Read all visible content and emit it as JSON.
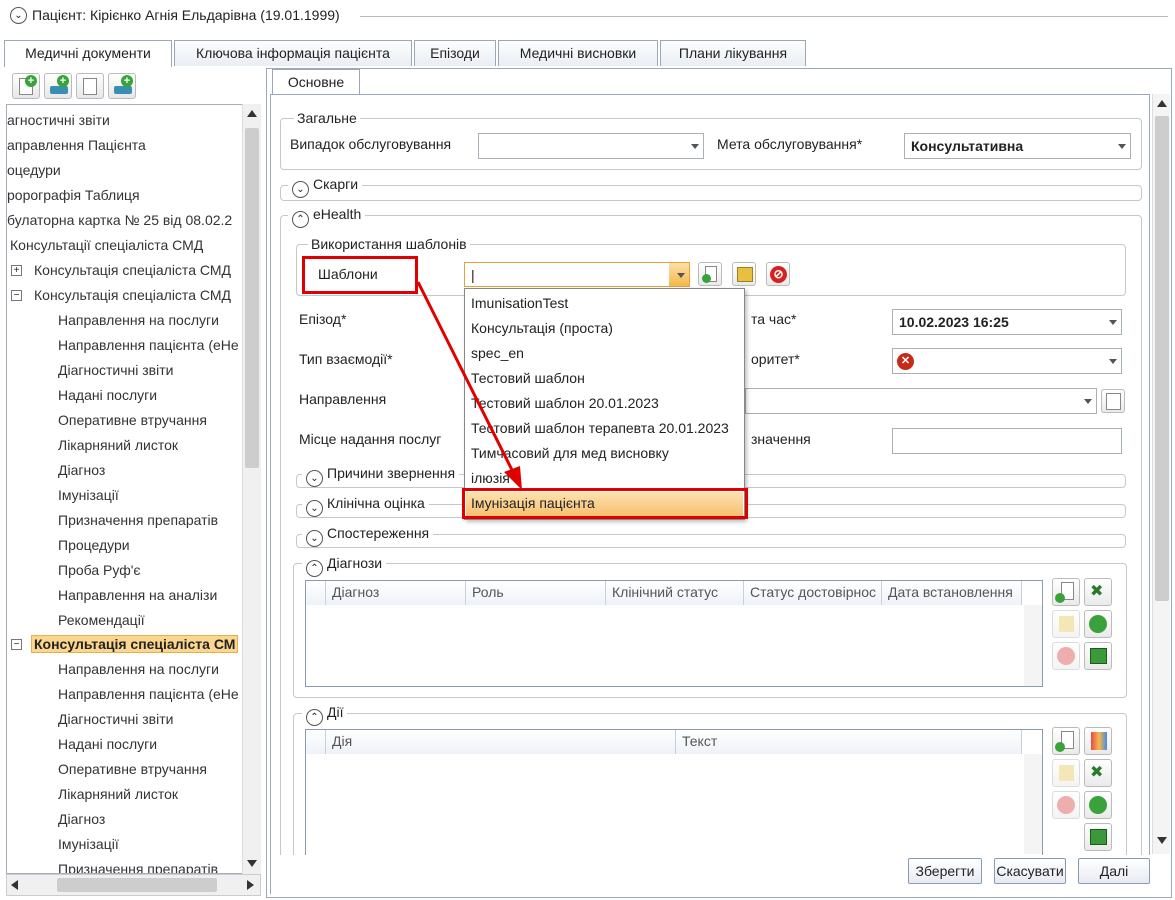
{
  "header": {
    "title": "Пацієнт: Кірієнко Агнія Ельдарівна (19.01.1999)"
  },
  "tabs": [
    {
      "label": "Медичні документи"
    },
    {
      "label": "Ключова інформація пацієнта"
    },
    {
      "label": "Епізоди"
    },
    {
      "label": "Медичні висновки"
    },
    {
      "label": "Плани лікування"
    }
  ],
  "tree": {
    "items": [
      "агностичні звіти",
      "аправлення Пацієнта",
      "оцедури",
      "рорографія Таблиця",
      "булаторна картка № 25 від 08.02.2",
      "Консультації спеціаліста СМД",
      "Консультація спеціаліста СМД",
      "Консультація спеціаліста СМД",
      "Направлення на послуги",
      "Направлення пацієнта (eHe",
      "Діагностичні звіти",
      "Надані послуги",
      "Оперативне втручання",
      "Лікарняний листок",
      "Діагноз",
      "Імунізації",
      "Призначення препаратів",
      "Процедури",
      "Проба Руф'є",
      "Направлення на аналізи",
      "Рекомендації",
      "Консультація спеціаліста СМ",
      "Направлення на послуги",
      "Направлення пацієнта (eHe",
      "Діагностичні звіти",
      "Надані послуги",
      "Оперативне втручання",
      "Лікарняний листок",
      "Діагноз",
      "Імунізації",
      "Призначення препаратів"
    ]
  },
  "subtab": {
    "label": "Основне"
  },
  "general": {
    "title": "Загальне",
    "case_label": "Випадок обслуговування",
    "case_value": "",
    "goal_label": "Мета обслуговування*",
    "goal_value": "Консультативна"
  },
  "sections": {
    "complaints": "Скарги",
    "ehealth": "eHealth",
    "templates_group": "Використання шаблонів",
    "templates_label": "Шаблони",
    "templates_value": "|",
    "episode_label": "Епізод*",
    "datetime_label": "та час*",
    "datetime_value": "10.02.2023 16:25",
    "interaction_label": "Тип взаємодії*",
    "priority_label": "оритет*",
    "referral_label": "Направлення",
    "place_label": "Місце надання послуг",
    "purpose_label": "значення",
    "reasons": "Причини звернення",
    "clinical": "Клінічна оцінка",
    "observations": "Спостереження",
    "diagnoses": "Діагнози",
    "actions": "Дії"
  },
  "dropdown": {
    "options": [
      "ImunisationTest",
      "Консультація (проста)",
      "spec_en",
      "Тестовий шаблон",
      "Тестовий шаблон 20.01.2023",
      "Тестовий шаблон терапевта 20.01.2023",
      "Тимчасовий для мед висновку",
      "ілюзія",
      "Імунізація пацієнта"
    ]
  },
  "diag_table": {
    "columns": [
      "Діагноз",
      "Роль",
      "Клінічний статус",
      "Статус достовірнос",
      "Дата встановлення"
    ]
  },
  "act_table": {
    "columns": [
      "Дія",
      "Текст"
    ]
  },
  "footer": {
    "save": "Зберегти",
    "cancel": "Скасувати",
    "next": "Далі"
  },
  "colors": {
    "highlight": "#e00000",
    "selection": "#fbd68e",
    "accent": "#9aa8b8"
  }
}
